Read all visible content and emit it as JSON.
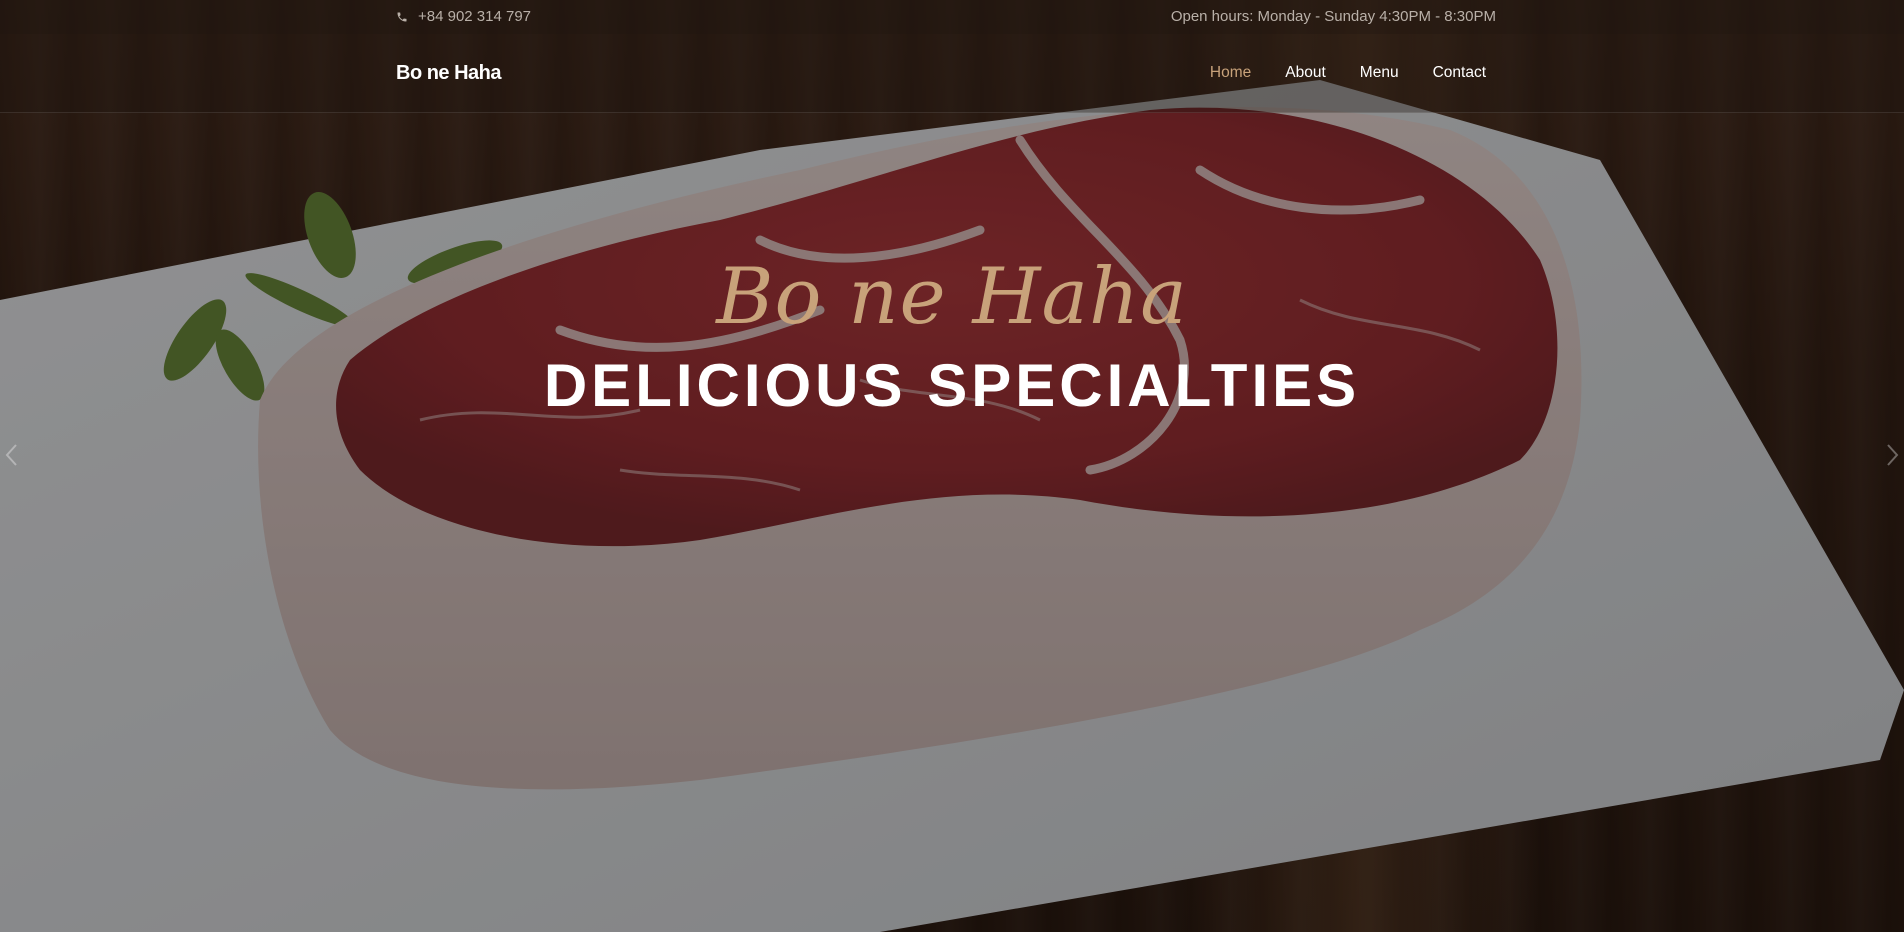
{
  "topbar": {
    "phone": "+84 902 314 797",
    "hours": "Open hours: Monday - Sunday 4:30PM - 8:30PM"
  },
  "navbar": {
    "brand": "Bo ne Haha",
    "links": [
      {
        "label": "Home",
        "active": true
      },
      {
        "label": "About",
        "active": false
      },
      {
        "label": "Menu",
        "active": false
      },
      {
        "label": "Contact",
        "active": false
      }
    ]
  },
  "hero": {
    "script_title": "Bo ne Haha",
    "heading": "DELICIOUS SPECIALTIES"
  },
  "colors": {
    "accent": "#c8a27a",
    "text": "#ffffff"
  },
  "icons": {
    "phone": "phone-icon",
    "prev": "chevron-left-icon",
    "next": "chevron-right-icon"
  }
}
